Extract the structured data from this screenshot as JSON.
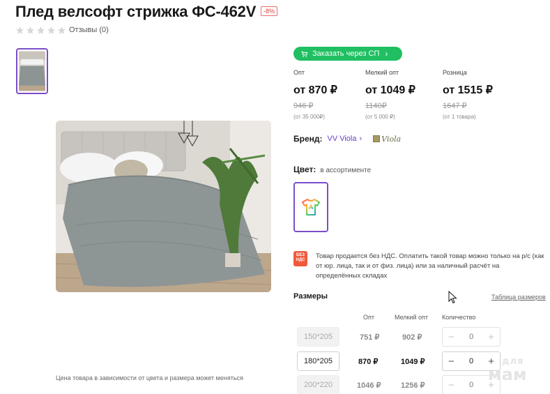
{
  "product": {
    "title": "Плед велсофт стрижка ФС-462V",
    "discount_badge": "-8%",
    "reviews_label": "Отзывы (0)",
    "rating_stars": 0,
    "price_note": "Цена товара в зависимости от цвета и размера может меняться"
  },
  "joint_purchase": {
    "label": "Заказать через СП",
    "chevron": "›"
  },
  "prices": [
    {
      "label": "Опт",
      "price": "от 870 ₽",
      "old": "946 ₽",
      "min": "(от 35 000₽)"
    },
    {
      "label": "Мелкий опт",
      "price": "от 1049 ₽",
      "old": "1140₽",
      "min": "(от 5 000 ₽)"
    },
    {
      "label": "Розница",
      "price": "от 1515 ₽",
      "old": "1647 ₽",
      "min": "(от 1 товара)"
    }
  ],
  "brand": {
    "label": "Бренд:",
    "name": "VV Viola",
    "chevron": "›",
    "logo_text": "Viola"
  },
  "color": {
    "label": "Цвет:",
    "value": "в ассортименте"
  },
  "vat": {
    "badge_line1": "БЕЗ",
    "badge_line2": "НДС",
    "text": "Товар продается без НДС. Оплатить такой товар можно только на р/с (как от юр. лица, так и от физ. лица) или за наличный расчёт на определённых складах"
  },
  "sizes": {
    "heading": "Размеры",
    "size_table_link": "Таблица размеров",
    "columns": {
      "opt": "Опт",
      "small_opt": "Мелкий опт",
      "qty": "Количество"
    },
    "rows": [
      {
        "size": "150*205",
        "opt": "751 ₽",
        "small_opt": "902 ₽",
        "qty": "0",
        "minus": "−",
        "plus": "+"
      },
      {
        "size": "180*205",
        "opt": "870 ₽",
        "small_opt": "1049 ₽",
        "qty": "0",
        "minus": "−",
        "plus": "+"
      },
      {
        "size": "200*220",
        "opt": "1046 ₽",
        "small_opt": "1256 ₽",
        "qty": "0",
        "minus": "−",
        "plus": "+"
      }
    ]
  },
  "watermark": {
    "line1": "для",
    "line2": "мам"
  },
  "colors": {
    "accent": "#7a4ec9",
    "green": "#1fbf62",
    "vat_badge": "#ef5a3c",
    "discount": "#e03b3b"
  }
}
